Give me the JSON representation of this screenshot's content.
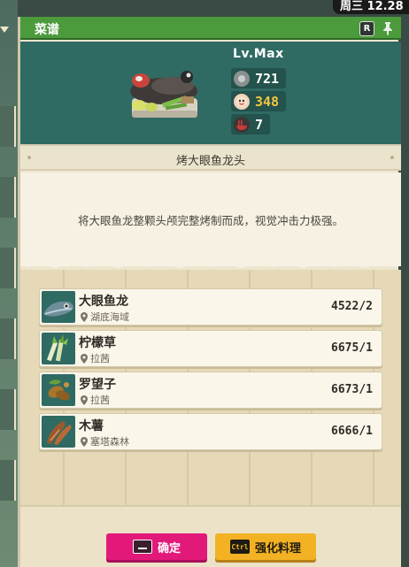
{
  "window": {
    "title": "菜谱",
    "day_time": "周三 12.28"
  },
  "recipe": {
    "level": "Lv.Max",
    "stats": [
      {
        "icon": "coin-icon",
        "value": "721",
        "color": "#ffffff"
      },
      {
        "icon": "bonus-icon",
        "value": "348",
        "color": "#f4c542"
      },
      {
        "icon": "bowl-icon",
        "value": "7",
        "color": "#ffffff"
      }
    ],
    "name": "烤大眼鱼龙头",
    "description": "将大眼鱼龙整颗头颅完整烤制而成，视觉冲击力极强。"
  },
  "ingredients": [
    {
      "name": "大眼鱼龙",
      "location": "湖底海域",
      "count": "4522/2",
      "icon": "fish-icon"
    },
    {
      "name": "柠檬草",
      "location": "拉茜",
      "count": "6675/1",
      "icon": "lemongrass-icon"
    },
    {
      "name": "罗望子",
      "location": "拉茜",
      "count": "6673/1",
      "icon": "tamarind-icon"
    },
    {
      "name": "木薯",
      "location": "塞塔森林",
      "count": "6666/1",
      "icon": "cassava-icon"
    }
  ],
  "buttons": {
    "confirm": "确定",
    "enhance": "强化料理",
    "key_r": "R",
    "key_ctrl": "Ctrl"
  },
  "colors": {
    "title_bar": "#4b9a3c",
    "header": "#2f6a63",
    "confirm": "#e3197a",
    "enhance": "#f2b224"
  }
}
